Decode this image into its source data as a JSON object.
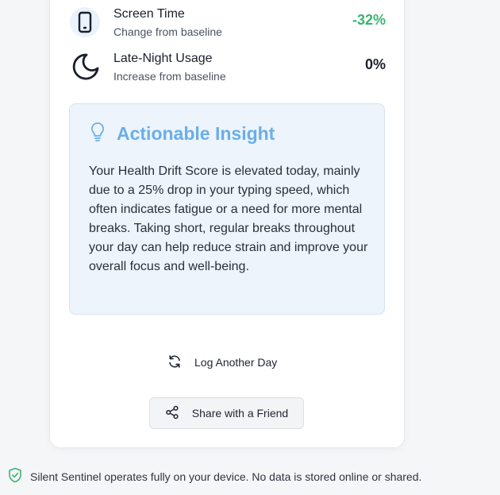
{
  "metrics": [
    {
      "title": "Screen Time",
      "subtitle": "Change from baseline",
      "value": "-32%",
      "value_color": "#3cb371",
      "icon": "smartphone-icon"
    },
    {
      "title": "Late-Night Usage",
      "subtitle": "Increase from baseline",
      "value": "0%",
      "value_color": "#1b1f2c",
      "icon": "moon-icon"
    }
  ],
  "insight": {
    "icon": "lightbulb-icon",
    "title": "Actionable Insight",
    "body": "Your Health Drift Score is elevated today, mainly due to a 25% drop in your typing speed, which often indicates fatigue or a need for more mental breaks. Taking short, regular breaks throughout your day can help reduce strain and improve your overall focus and well-being."
  },
  "actions": {
    "log_label": "Log Another Day",
    "log_icon": "refresh-icon",
    "share_label": "Share with a Friend",
    "share_icon": "share-icon"
  },
  "footer": {
    "icon": "shield-check-icon",
    "text": "Silent Sentinel operates fully on your device. No data is stored online or shared."
  },
  "colors": {
    "accent": "#6aaee8",
    "positive": "#3cb371",
    "shield": "#3cb371"
  }
}
